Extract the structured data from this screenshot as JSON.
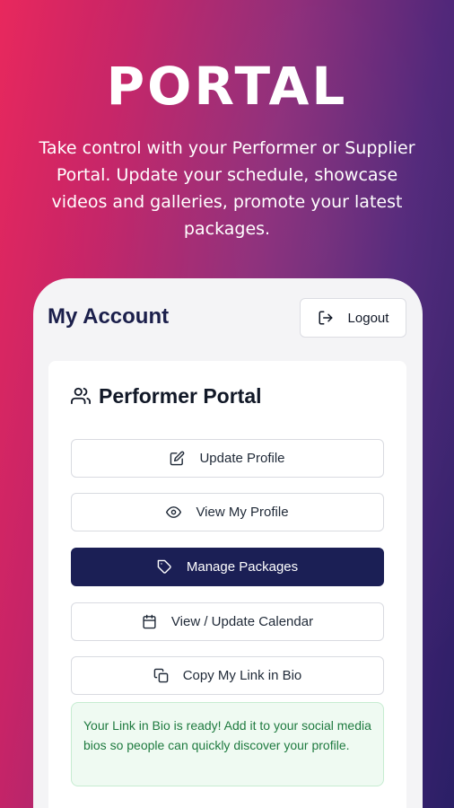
{
  "hero": {
    "title": "PORTAL",
    "subtitle": "Take control with your Performer or Supplier Portal. Update your schedule, showcase videos and galleries, promote your latest packages."
  },
  "account": {
    "title": "My Account",
    "logout_label": "Logout",
    "logout_icon": "logout-icon"
  },
  "portal": {
    "title": "Performer Portal",
    "icon": "users-icon",
    "buttons": [
      {
        "label": "Update Profile",
        "icon": "edit-icon"
      },
      {
        "label": "View My Profile",
        "icon": "eye-icon"
      },
      {
        "label": "Manage Packages",
        "icon": "tag-icon",
        "active": true
      },
      {
        "label": "View / Update Calendar",
        "icon": "calendar-icon"
      },
      {
        "label": "Copy My Link in Bio",
        "icon": "copy-icon"
      }
    ],
    "notice": "Your Link in Bio is ready! Add it to your social media bios so people can quickly discover your profile."
  },
  "colors": {
    "gradient_start": "#e8285d",
    "gradient_end": "#2a1f66",
    "primary_button": "#1b1f55",
    "notice_bg": "#effaf2",
    "notice_text": "#1e7a3f"
  }
}
